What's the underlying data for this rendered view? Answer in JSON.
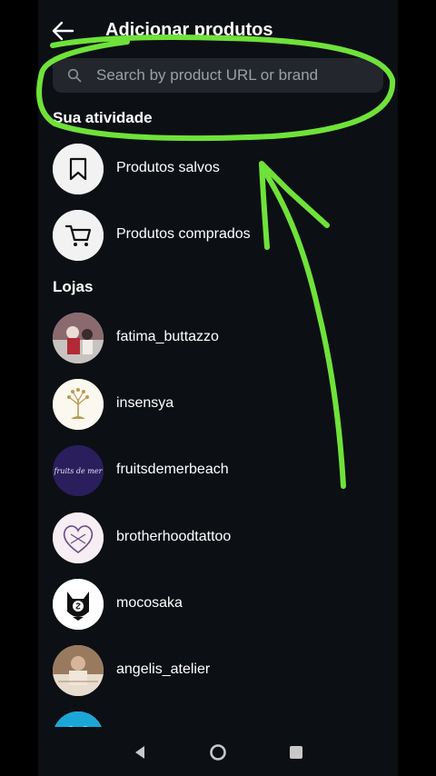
{
  "header": {
    "title": "Adicionar produtos"
  },
  "search": {
    "placeholder": "Search by product URL or brand"
  },
  "activity": {
    "title": "Sua atividade",
    "items": [
      {
        "label": "Produtos salvos",
        "icon": "bookmark-icon"
      },
      {
        "label": "Produtos comprados",
        "icon": "cart-icon"
      }
    ]
  },
  "stores": {
    "title": "Lojas",
    "items": [
      {
        "label": "fatima_buttazzo"
      },
      {
        "label": "insensya"
      },
      {
        "label": "fruitsdemerbeach",
        "logo_text": "fruits de mer"
      },
      {
        "label": "brotherhoodtattoo"
      },
      {
        "label": "mocosaka"
      },
      {
        "label": "angelis_atelier"
      },
      {
        "label": ""
      }
    ]
  },
  "colors": {
    "background": "#0c0f14",
    "search_bg": "#23262d",
    "annotation": "#6fe23a",
    "text": "#ffffff"
  }
}
